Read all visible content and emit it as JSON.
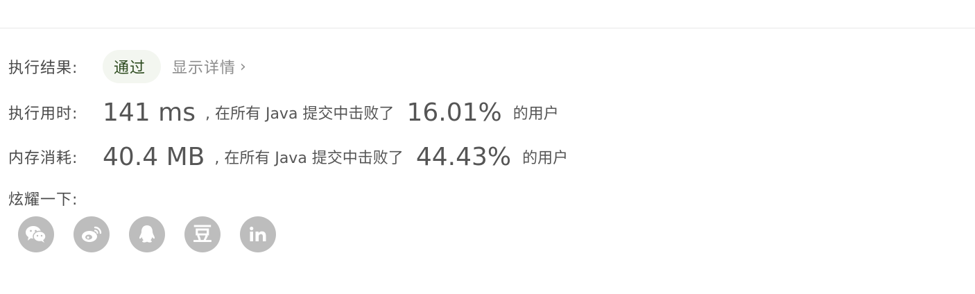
{
  "result": {
    "label": "执行结果:",
    "status": "通过",
    "details_link": "显示详情",
    "details_chevron": "›"
  },
  "runtime": {
    "label": "执行用时:",
    "value": "141 ms",
    "middle_text": ", 在所有 Java 提交中击败了",
    "percent": "16.01%",
    "tail_text": "的用户"
  },
  "memory": {
    "label": "内存消耗:",
    "value": "40.4 MB",
    "middle_text": ", 在所有 Java 提交中击败了",
    "percent": "44.43%",
    "tail_text": "的用户"
  },
  "share": {
    "label": "炫耀一下:",
    "icons": [
      "wechat-icon",
      "weibo-icon",
      "qq-icon",
      "douban-icon",
      "linkedin-icon"
    ],
    "douban_glyph": "豆"
  },
  "colors": {
    "pass_bg": "#f3f6f0",
    "pass_text": "#2c4a1e",
    "icon_bg": "#bdbdbd",
    "muted": "#8c8c8c"
  }
}
